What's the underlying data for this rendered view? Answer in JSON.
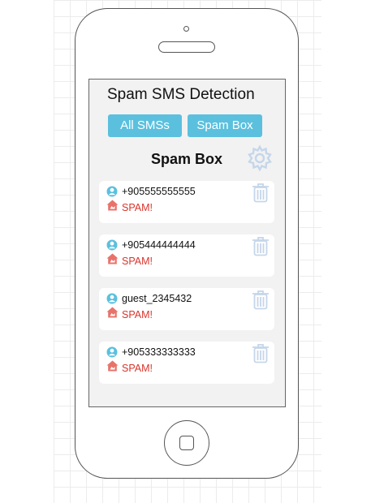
{
  "app": {
    "title": "Spam SMS Detection"
  },
  "tabs": [
    {
      "label": "All SMSs",
      "active": false
    },
    {
      "label": "Spam Box",
      "active": true
    }
  ],
  "section": {
    "title": "Spam Box",
    "settings_icon": "gear-icon"
  },
  "messages": [
    {
      "sender": "+905555555555",
      "status": "SPAM!",
      "user_icon": "user-icon",
      "status_icon": "spam-house-icon",
      "action_icon": "trash-icon"
    },
    {
      "sender": "+905444444444",
      "status": "SPAM!",
      "user_icon": "user-icon",
      "status_icon": "spam-house-icon",
      "action_icon": "trash-icon"
    },
    {
      "sender": "guest_2345432",
      "status": "SPAM!",
      "user_icon": "user-icon",
      "status_icon": "spam-house-icon",
      "action_icon": "trash-icon"
    },
    {
      "sender": "+905333333333",
      "status": "SPAM!",
      "user_icon": "user-icon",
      "status_icon": "spam-house-icon",
      "action_icon": "trash-icon"
    }
  ],
  "colors": {
    "tab_bg": "#5bc0de",
    "tab_text": "#ffffff",
    "spam_text": "#d9342b",
    "spam_icon": "#e8736b",
    "user_icon": "#5bc0de",
    "icon_light": "#c5d6ea",
    "screen_bg": "#f2f2f2",
    "card_bg": "#ffffff"
  }
}
